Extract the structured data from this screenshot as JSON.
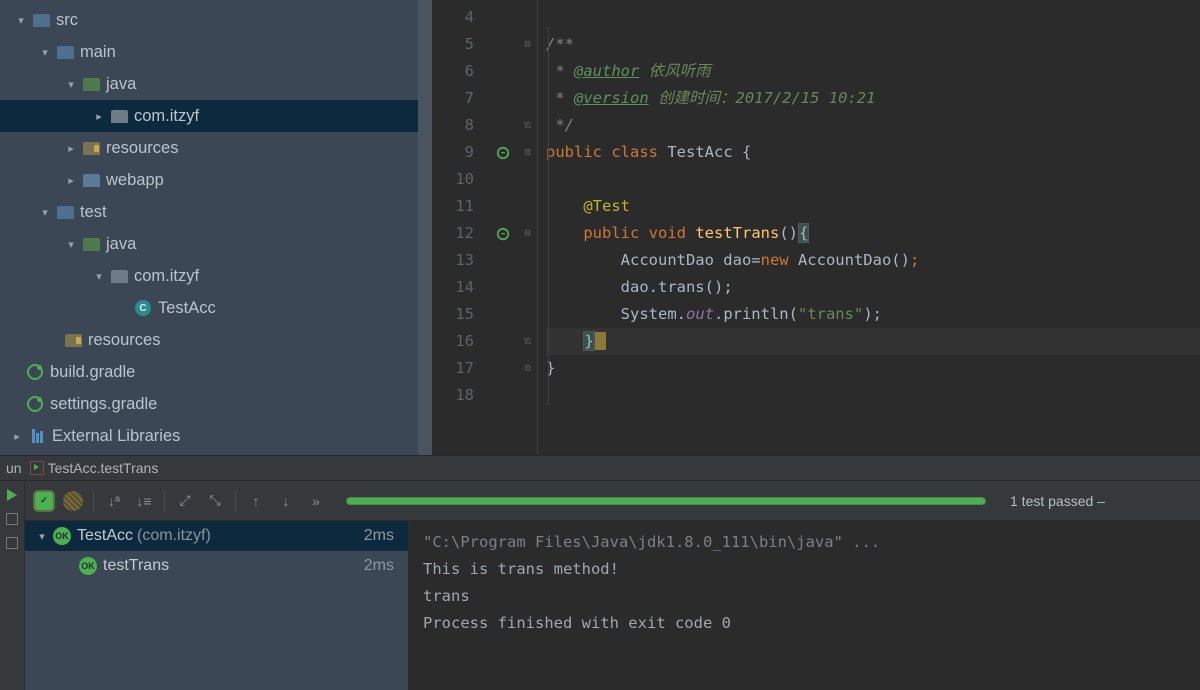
{
  "tree": {
    "src": "src",
    "main": "main",
    "java_main": "java",
    "pkg_main": "com.itzyf",
    "resources_main": "resources",
    "webapp": "webapp",
    "test": "test",
    "java_test": "java",
    "pkg_test": "com.itzyf",
    "testacc": "TestAcc",
    "resources_test": "resources",
    "build_gradle": "build.gradle",
    "settings_gradle": "settings.gradle",
    "external_libs": "External Libraries"
  },
  "editor": {
    "lines": {
      "l4": "4",
      "l5": "5",
      "l6": "6",
      "l7": "7",
      "l8": "8",
      "l9": "9",
      "l10": "10",
      "l11": "11",
      "l12": "12",
      "l13": "13",
      "l14": "14",
      "l15": "15",
      "l16": "16",
      "l17": "17",
      "l18": "18"
    },
    "code": {
      "c5a": "/**",
      "c6a": " * ",
      "c6b": "@author",
      "c6c": " 依风听雨",
      "c7a": " * ",
      "c7b": "@version",
      "c7c": " 创建时间：2017/2/15 10:21",
      "c8a": " */",
      "c9a": "public ",
      "c9b": "class ",
      "c9c": "TestAcc ",
      "c9d": "{",
      "c11a": "@Test",
      "c12a": "public ",
      "c12b": "void ",
      "c12c": "testTrans",
      "c12d": "()",
      "c12e": "{",
      "c13a": "AccountDao dao=",
      "c13b": "new ",
      "c13c": "AccountDao()",
      "c13d": ";",
      "c14a": "dao.",
      "c14b": "trans",
      "c14c": "();",
      "c15a": "System.",
      "c15b": "out",
      "c15c": ".println(",
      "c15d": "\"trans\"",
      "c15e": ");",
      "c16a": "}",
      "c17a": "}"
    }
  },
  "bottom": {
    "run_label": "un",
    "test_tab": "TestAcc.testTrans"
  },
  "run": {
    "test_passed": "1 test passed –",
    "root_name": "TestAcc",
    "root_pkg": "(com.itzyf)",
    "root_time": "2ms",
    "child_name": "testTrans",
    "child_time": "2ms"
  },
  "console": {
    "l1": "\"C:\\Program Files\\Java\\jdk1.8.0_111\\bin\\java\" ...",
    "l2": "This is trans method!",
    "l3": "trans",
    "l4": "",
    "l5": "Process finished with exit code 0"
  }
}
